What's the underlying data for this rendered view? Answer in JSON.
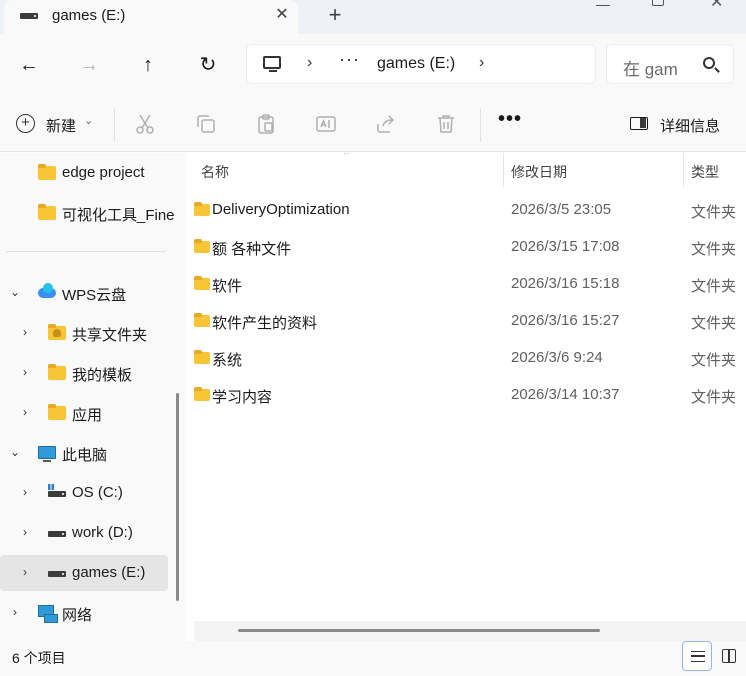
{
  "tab": {
    "title": "games (E:)",
    "close_glyph": "✕",
    "new_tab_glyph": "+",
    "icon": "drive-icon"
  },
  "window_controls": {
    "minimize_icon": "minimize-icon",
    "maximize_icon": "maximize-icon",
    "close_glyph": "✕"
  },
  "nav": {
    "back_glyph": "←",
    "forward_glyph": "→",
    "up_glyph": "↑",
    "refresh_glyph": "↻"
  },
  "address": {
    "sep1": "›",
    "ellipsis": "···",
    "current": "games (E:)",
    "sep2": "›",
    "icon": "computer-icon"
  },
  "search": {
    "placeholder": "在 games (E:) 中搜索",
    "visible_text": "在 gam"
  },
  "toolbar": {
    "new_label": "新建",
    "new_chevron": "⌄",
    "more_glyph": "•••",
    "details_label": "详细信息",
    "icons": [
      "cut-icon",
      "copy-icon",
      "paste-icon",
      "rename-icon",
      "share-icon",
      "delete-icon"
    ]
  },
  "sidebar": {
    "quick_items": [
      {
        "label": "edge project"
      },
      {
        "label": "可视化工具_Fine"
      }
    ],
    "cloud": {
      "label": "WPS云盘",
      "expanded": true,
      "chevron": "⌄"
    },
    "cloud_children": [
      {
        "label": "共享文件夹",
        "chevron": "›"
      },
      {
        "label": "我的模板",
        "chevron": "›"
      },
      {
        "label": "应用",
        "chevron": "›"
      }
    ],
    "pc": {
      "label": "此电脑",
      "expanded": true,
      "chevron": "⌄"
    },
    "drives": [
      {
        "label": "OS (C:)",
        "chevron": "›"
      },
      {
        "label": "work (D:)",
        "chevron": "›"
      },
      {
        "label": "games (E:)",
        "chevron": "›",
        "selected": true
      }
    ],
    "network": {
      "label": "网络",
      "chevron": "›"
    }
  },
  "columns": {
    "name": "名称",
    "modified": "修改日期",
    "type": "类型",
    "sort_glyph": "⌃"
  },
  "files": [
    {
      "name": "DeliveryOptimization",
      "modified": "2026/3/5 23:05",
      "type": "文件夹"
    },
    {
      "name": "额  各种文件",
      "modified": "2026/3/15 17:08",
      "type": "文件夹"
    },
    {
      "name": "软件",
      "modified": "2026/3/16 15:18",
      "type": "文件夹"
    },
    {
      "name": "软件产生的资料",
      "modified": "2026/3/16 15:27",
      "type": "文件夹"
    },
    {
      "name": "系统",
      "modified": "2026/3/6 9:24",
      "type": "文件夹"
    },
    {
      "name": "学习内容",
      "modified": "2026/3/14 10:37",
      "type": "文件夹"
    }
  ],
  "status": {
    "count": "6 个项目"
  },
  "colors": {
    "folder": "#f8c537",
    "accent": "#90b8e8",
    "background": "#f9f9f9"
  }
}
